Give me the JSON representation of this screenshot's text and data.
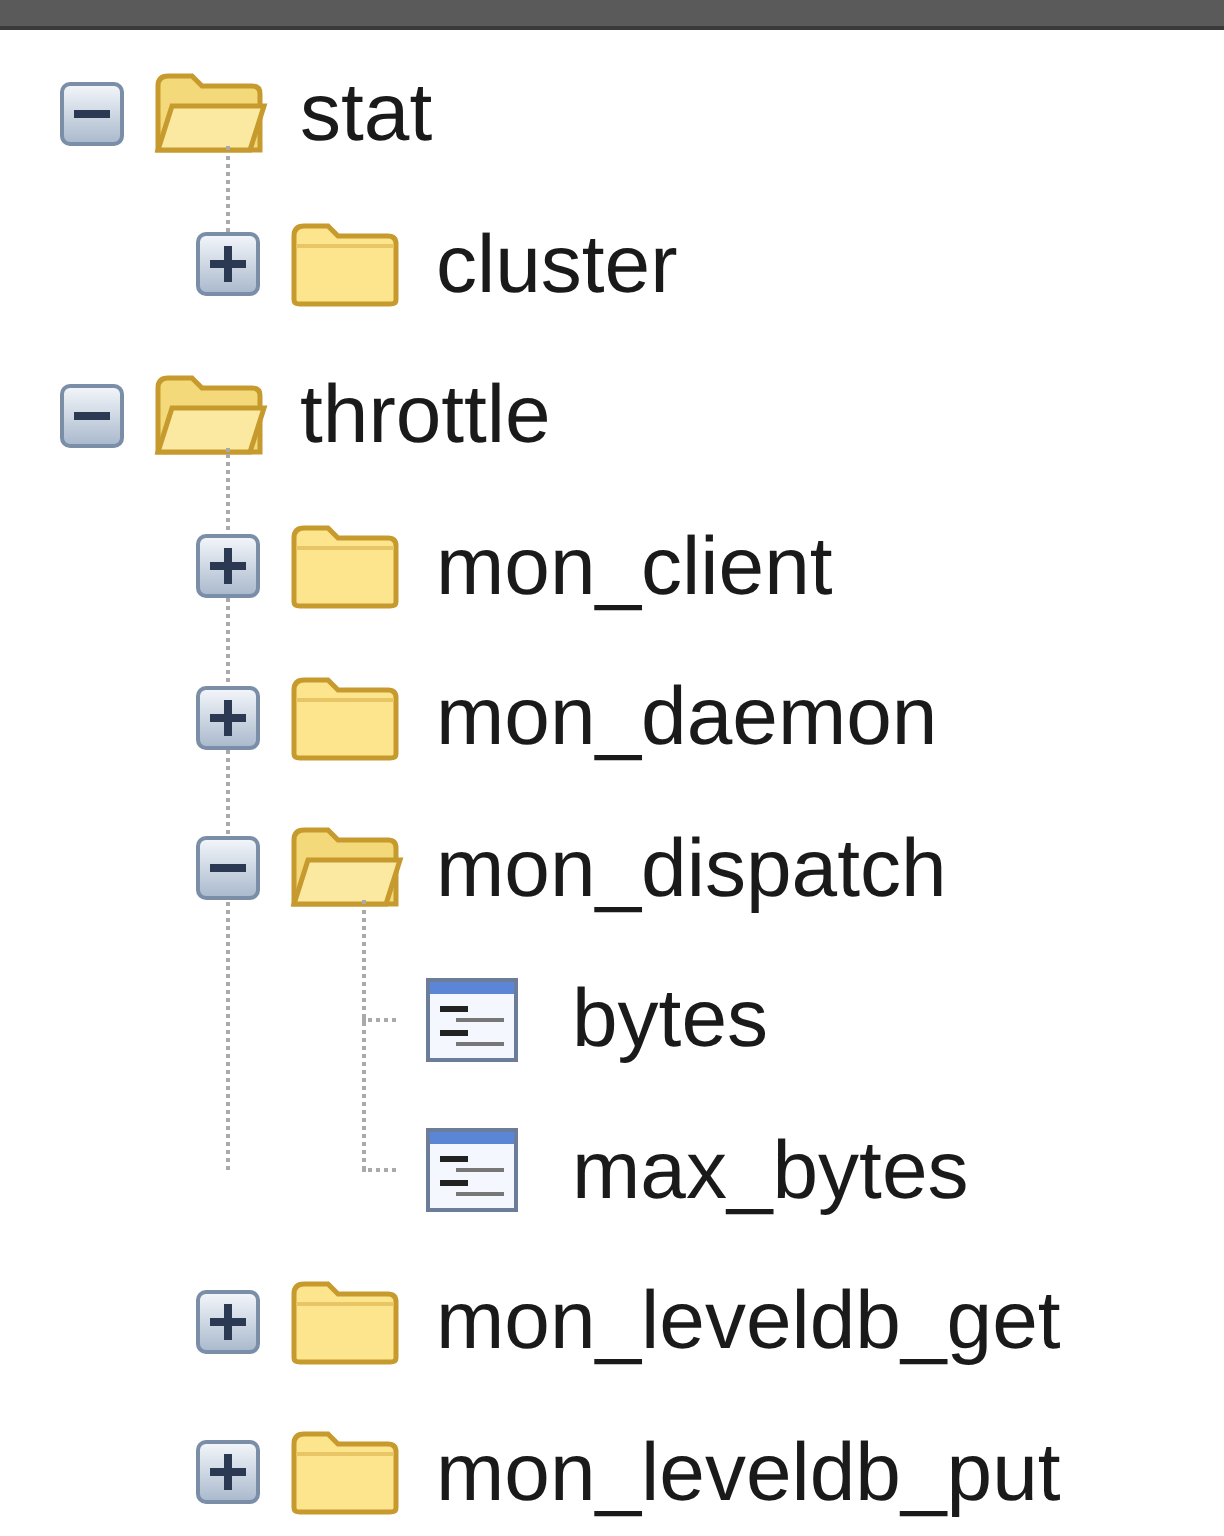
{
  "tree": [
    {
      "label": "stat",
      "kind": "folder",
      "expanded": true,
      "children": [
        {
          "label": "cluster",
          "kind": "folder",
          "expanded": false
        }
      ]
    },
    {
      "label": "throttle",
      "kind": "folder",
      "expanded": true,
      "children": [
        {
          "label": "mon_client",
          "kind": "folder",
          "expanded": false
        },
        {
          "label": "mon_daemon",
          "kind": "folder",
          "expanded": false
        },
        {
          "label": "mon_dispatch",
          "kind": "folder",
          "expanded": true,
          "children": [
            {
              "label": "bytes",
              "kind": "leaf"
            },
            {
              "label": "max_bytes",
              "kind": "leaf"
            }
          ]
        },
        {
          "label": "mon_leveldb_get",
          "kind": "folder",
          "expanded": false
        },
        {
          "label": "mon_leveldb_put",
          "kind": "folder",
          "expanded": false
        }
      ]
    }
  ]
}
